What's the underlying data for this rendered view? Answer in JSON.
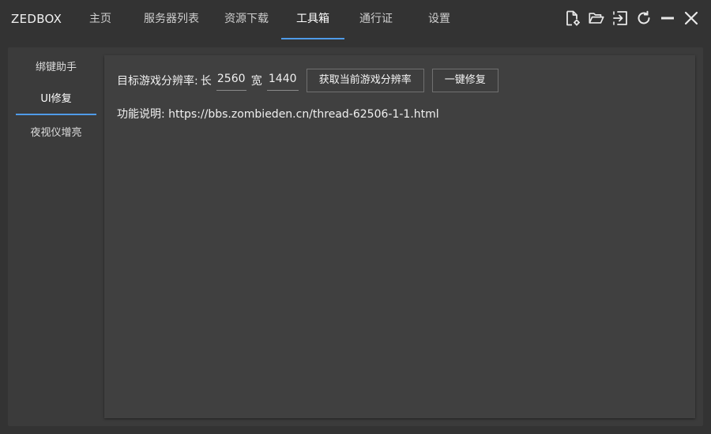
{
  "app": {
    "title": "ZEDBOX"
  },
  "nav": {
    "tabs": [
      {
        "label": "主页"
      },
      {
        "label": "服务器列表"
      },
      {
        "label": "资源下载"
      },
      {
        "label": "工具箱",
        "active": true
      },
      {
        "label": "通行证"
      },
      {
        "label": "设置"
      }
    ]
  },
  "window_controls": {
    "icons": [
      "file-settings-icon",
      "folder-open-icon",
      "login-icon",
      "refresh-icon",
      "minimize-icon",
      "close-icon"
    ]
  },
  "sidebar": {
    "items": [
      {
        "label": "绑键助手"
      },
      {
        "label": "UI修复",
        "active": true
      },
      {
        "label": "夜视仪增亮"
      }
    ]
  },
  "panel": {
    "resolution_label": "目标游戏分辨率:",
    "width_label": "长",
    "width_value": "2560",
    "height_label": "宽",
    "height_value": "1440",
    "get_resolution_button": "获取当前游戏分辨率",
    "fix_button": "一键修复",
    "description": "功能说明: https://bbs.zombieden.cn/thread-62506-1-1.html"
  },
  "colors": {
    "background": "#333333",
    "panel": "#404040",
    "accent": "#4f9be8"
  }
}
